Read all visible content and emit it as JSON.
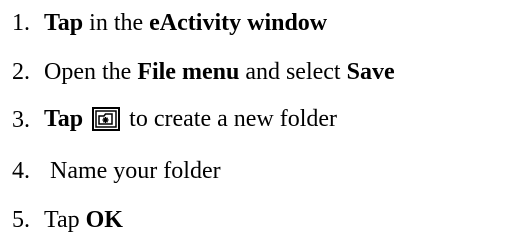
{
  "steps": [
    {
      "number": "1.",
      "parts": [
        {
          "text": "Tap",
          "bold": true
        },
        {
          "text": " in the ",
          "bold": false
        },
        {
          "text": "eActivity window",
          "bold": true
        }
      ]
    },
    {
      "number": "2.",
      "parts": [
        {
          "text": "Open the ",
          "bold": false
        },
        {
          "text": "File menu",
          "bold": true
        },
        {
          "text": " and select ",
          "bold": false
        },
        {
          "text": "Save",
          "bold": true
        }
      ]
    },
    {
      "number": "3.",
      "parts": [
        {
          "text": "Tap",
          "bold": true
        },
        {
          "text": " ",
          "bold": false
        },
        {
          "icon": "new-folder-icon"
        },
        {
          "text": " to create a new folder",
          "bold": false
        }
      ]
    },
    {
      "number": "4.",
      "parts": [
        {
          "text": " Name your folder",
          "bold": false
        }
      ]
    },
    {
      "number": "5.",
      "parts": [
        {
          "text": "Tap ",
          "bold": false
        },
        {
          "text": "OK",
          "bold": true
        }
      ]
    }
  ]
}
